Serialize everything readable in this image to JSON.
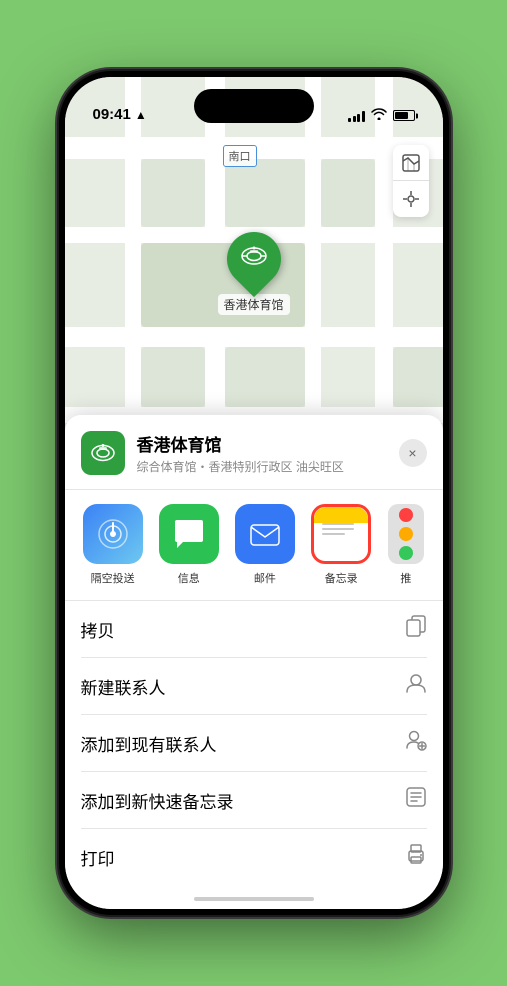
{
  "statusBar": {
    "time": "09:41",
    "locationIcon": "▶"
  },
  "map": {
    "label": "南口",
    "locationName": "香港体育馆",
    "pinLabel": "香港体育馆"
  },
  "locationSheet": {
    "name": "香港体育馆",
    "subtitle": "综合体育馆・香港特别行政区 油尖旺区",
    "closeLabel": "×"
  },
  "shareItems": [
    {
      "id": "airdrop",
      "label": "隔空投送",
      "type": "airdrop"
    },
    {
      "id": "messages",
      "label": "信息",
      "type": "messages"
    },
    {
      "id": "mail",
      "label": "邮件",
      "type": "mail"
    },
    {
      "id": "notes",
      "label": "备忘录",
      "type": "notes",
      "selected": true
    },
    {
      "id": "more",
      "label": "推",
      "type": "more"
    }
  ],
  "actionItems": [
    {
      "id": "copy",
      "label": "拷贝",
      "icon": "copy"
    },
    {
      "id": "new-contact",
      "label": "新建联系人",
      "icon": "person-add"
    },
    {
      "id": "add-existing",
      "label": "添加到现有联系人",
      "icon": "person-plus"
    },
    {
      "id": "add-note",
      "label": "添加到新快速备忘录",
      "icon": "note"
    },
    {
      "id": "print",
      "label": "打印",
      "icon": "printer"
    }
  ]
}
